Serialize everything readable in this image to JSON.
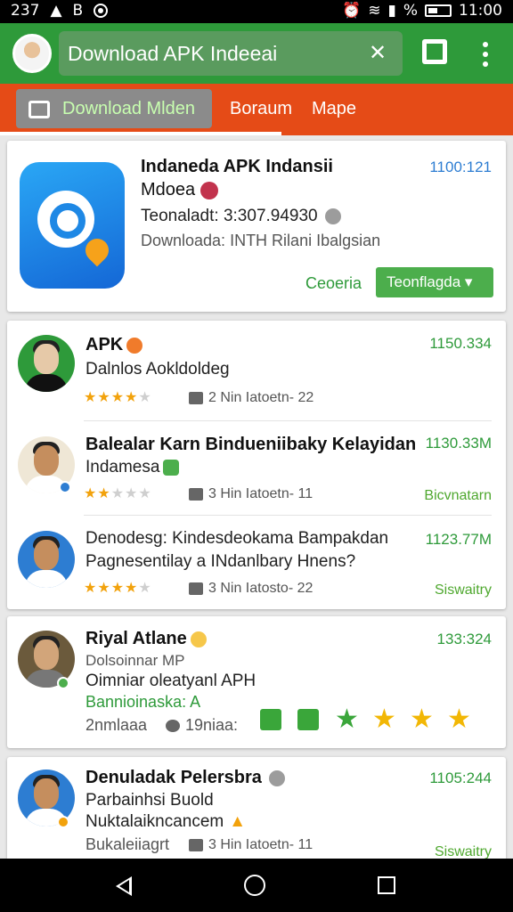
{
  "status_bar": {
    "left_text": "237",
    "left_letter": "B",
    "battery_text": "%",
    "time": "11:00"
  },
  "app_bar": {
    "search_value": "Download APK Indeeai",
    "search_action_icon": "no-signal-icon",
    "overflow_icon": "more-vertical-icon"
  },
  "tabs": [
    {
      "label": "Download Mlden",
      "active": true
    },
    {
      "label": "Boraum"
    },
    {
      "label": "Mape"
    }
  ],
  "featured": {
    "title_line1": "Indaneda APK Indansii",
    "title_line2": "Mdoea",
    "time": "1100:121",
    "teonaladt": "Teonaladt: 3:307.94930",
    "downloads": "Downloada: INTH Rilani Ibalgsian",
    "link_label": "Ceoeria",
    "button_label": "Teonflagda"
  },
  "list": [
    {
      "name": "APK",
      "subtitle": "Dalnlos Aokldoldeg",
      "time": "1150.334",
      "rating": 4,
      "meta": "2 Nin Iatoetn- 22",
      "status": ""
    },
    {
      "name": "Balealar Karn Bindueniibaky Kelayidan",
      "name_line2": "Indamesa",
      "time": "1130.33M",
      "rating": 2,
      "meta": "3 Hin Iatoetn- 11",
      "status": "Bicvnatarn"
    },
    {
      "name": "Denodesg: Kindesdeokama Bampakdan",
      "name_line2": "Pagnesentilay a INdanlbary Hnens?",
      "time": "1123.77M",
      "rating": 4,
      "meta": "3 Nin Iatosto- 22",
      "status": "Siswaitry"
    }
  ],
  "post": {
    "name": "Riyal Atlane",
    "line1": "Dolsoinnar MP",
    "line2": "Oimniar oleatyanl APH",
    "highlight": "Bannioinaska: A",
    "stat1": "2nmlaaa",
    "stat2": "19niaa:",
    "time": "133:324"
  },
  "last": {
    "name": "Denuladak Pelersbra",
    "line1": "Parbainhsi Buold",
    "line2": "Nuktalaikncancem",
    "bottom": "Bukaleiiagrt",
    "meta": "3 Hin Iatoetn- 11",
    "time": "1105:244",
    "status": "Siswaitry"
  }
}
